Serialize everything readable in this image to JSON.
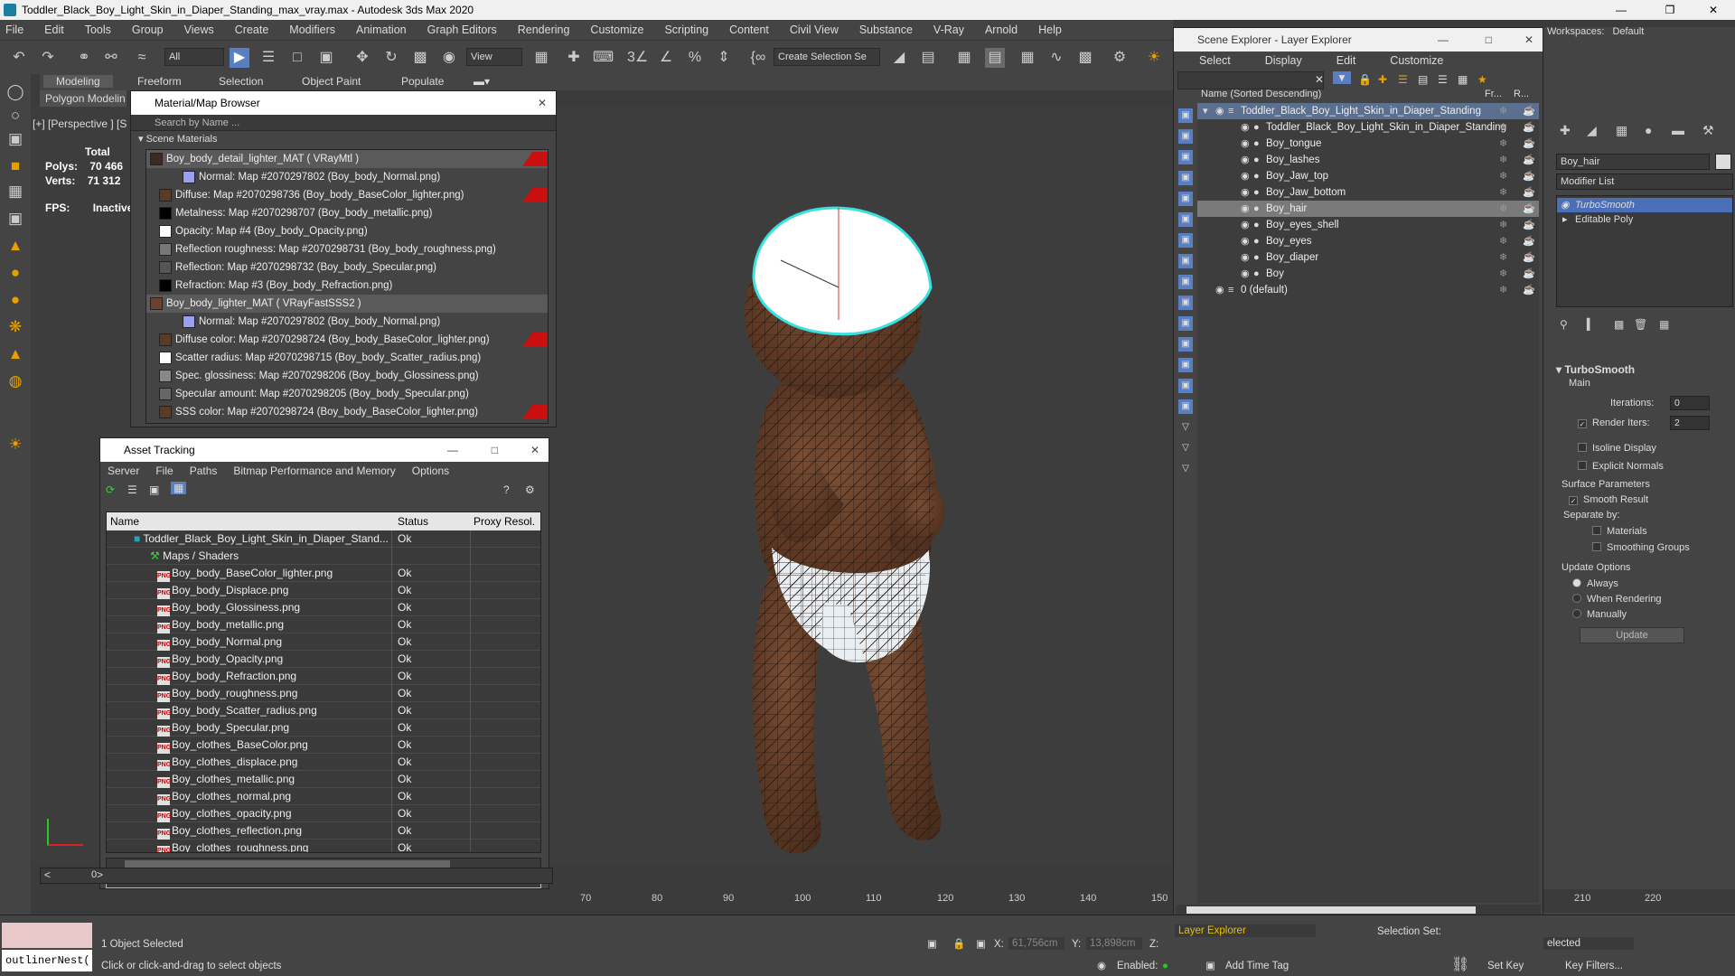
{
  "window": {
    "title": "Toddler_Black_Boy_Light_Skin_in_Diaper_Standing_max_vray.max - Autodesk 3ds Max 2020",
    "workspaces_label": "Workspaces:",
    "workspaces_value": "Default"
  },
  "menu": [
    "File",
    "Edit",
    "Tools",
    "Group",
    "Views",
    "Create",
    "Modifiers",
    "Animation",
    "Graph Editors",
    "Rendering",
    "Customize",
    "Scripting",
    "Content",
    "Civil View",
    "Substance",
    "V-Ray",
    "Arnold",
    "Help"
  ],
  "toolbar": {
    "filter_value": "All",
    "view_value": "View",
    "selection_set_value": "Create Selection Se"
  },
  "ribbon": {
    "tabs": [
      "Modeling",
      "Freeform",
      "Selection",
      "Object Paint",
      "Populate"
    ],
    "sub_tab": "Polygon Modelin"
  },
  "viewport": {
    "label": "[+] [Perspective ] [S",
    "stats_total": "Total",
    "polys_label": "Polys:",
    "polys_value": "70 466",
    "verts_label": "Verts:",
    "verts_value": "71 312",
    "fps_label": "FPS:",
    "fps_value": "Inactive"
  },
  "material_browser": {
    "title": "Material/Map Browser",
    "search_placeholder": "Search by Name ...",
    "section": "Scene Materials",
    "rows": [
      {
        "text": "Boy_body_detail_lighter_MAT  ( VRayMtl )",
        "kind": "mat",
        "swatch": "#3a2a22",
        "red": true
      },
      {
        "text": "Normal: Map #2070297802 (Boy_body_Normal.png)",
        "kind": "map2",
        "swatch": "#9aa0f0",
        "red": false
      },
      {
        "text": "Diffuse: Map #2070298736 (Boy_body_BaseColor_lighter.png)",
        "kind": "map",
        "swatch": "#5a3a28",
        "red": true
      },
      {
        "text": "Metalness: Map #2070298707 (Boy_body_metallic.png)",
        "kind": "map",
        "swatch": "#000000",
        "red": false
      },
      {
        "text": "Opacity: Map #4 (Boy_body_Opacity.png)",
        "kind": "map",
        "swatch": "#ffffff",
        "red": false
      },
      {
        "text": "Reflection roughness: Map #2070298731 (Boy_body_roughness.png)",
        "kind": "map",
        "swatch": "#777777",
        "red": false
      },
      {
        "text": "Reflection: Map #2070298732 (Boy_body_Specular.png)",
        "kind": "map",
        "swatch": "#555555",
        "red": false
      },
      {
        "text": "Refraction: Map #3 (Boy_body_Refraction.png)",
        "kind": "map",
        "swatch": "#000000",
        "red": false
      },
      {
        "text": "Boy_body_lighter_MAT  ( VRayFastSSS2 )",
        "kind": "mat",
        "swatch": "#6a4030",
        "red": false
      },
      {
        "text": "Normal: Map #2070297802 (Boy_body_Normal.png)",
        "kind": "map2",
        "swatch": "#9aa0f0",
        "red": false
      },
      {
        "text": "Diffuse color: Map #2070298724 (Boy_body_BaseColor_lighter.png)",
        "kind": "map",
        "swatch": "#5a3a28",
        "red": true
      },
      {
        "text": "Scatter radius: Map #2070298715 (Boy_body_Scatter_radius.png)",
        "kind": "map",
        "swatch": "#ffffff",
        "red": false
      },
      {
        "text": "Spec. glossiness: Map #2070298206 (Boy_body_Glossiness.png)",
        "kind": "map",
        "swatch": "#888888",
        "red": false
      },
      {
        "text": "Specular amount: Map #2070298205 (Boy_body_Specular.png)",
        "kind": "map",
        "swatch": "#666666",
        "red": false
      },
      {
        "text": "SSS color: Map #2070298724 (Boy_body_BaseColor_lighter.png)",
        "kind": "map",
        "swatch": "#5a3a28",
        "red": true
      }
    ]
  },
  "asset_tracking": {
    "title": "Asset Tracking",
    "menu": [
      "Server",
      "File",
      "Paths",
      "Bitmap Performance and Memory",
      "Options"
    ],
    "col_name": "Name",
    "col_status": "Status",
    "col_proxy": "Proxy Resol.",
    "rows": [
      {
        "name": "Toddler_Black_Boy_Light_Skin_in_Diaper_Stand...",
        "status": "Ok",
        "level": 0
      },
      {
        "name": "Maps / Shaders",
        "status": "",
        "level": 1
      },
      {
        "name": "Boy_body_BaseColor_lighter.png",
        "status": "Ok",
        "level": 2
      },
      {
        "name": "Boy_body_Displace.png",
        "status": "Ok",
        "level": 2
      },
      {
        "name": "Boy_body_Glossiness.png",
        "status": "Ok",
        "level": 2
      },
      {
        "name": "Boy_body_metallic.png",
        "status": "Ok",
        "level": 2
      },
      {
        "name": "Boy_body_Normal.png",
        "status": "Ok",
        "level": 2
      },
      {
        "name": "Boy_body_Opacity.png",
        "status": "Ok",
        "level": 2
      },
      {
        "name": "Boy_body_Refraction.png",
        "status": "Ok",
        "level": 2
      },
      {
        "name": "Boy_body_roughness.png",
        "status": "Ok",
        "level": 2
      },
      {
        "name": "Boy_body_Scatter_radius.png",
        "status": "Ok",
        "level": 2
      },
      {
        "name": "Boy_body_Specular.png",
        "status": "Ok",
        "level": 2
      },
      {
        "name": "Boy_clothes_BaseColor.png",
        "status": "Ok",
        "level": 2
      },
      {
        "name": "Boy_clothes_displace.png",
        "status": "Ok",
        "level": 2
      },
      {
        "name": "Boy_clothes_metallic.png",
        "status": "Ok",
        "level": 2
      },
      {
        "name": "Boy_clothes_normal.png",
        "status": "Ok",
        "level": 2
      },
      {
        "name": "Boy_clothes_opacity.png",
        "status": "Ok",
        "level": 2
      },
      {
        "name": "Boy_clothes_reflection.png",
        "status": "Ok",
        "level": 2
      },
      {
        "name": "Boy_clothes_roughness.png",
        "status": "Ok",
        "level": 2
      }
    ]
  },
  "layer_explorer": {
    "title": "Scene Explorer - Layer Explorer",
    "menu": [
      "Select",
      "Display",
      "Edit",
      "Customize"
    ],
    "col_name": "Name (Sorted Descending)",
    "col_frozen": "Fr...",
    "col_render": "R...",
    "rows": [
      {
        "name": "Toddler_Black_Boy_Light_Skin_in_Diaper_Standing",
        "level": 0,
        "state": "top"
      },
      {
        "name": "Toddler_Black_Boy_Light_Skin_in_Diaper_Standing",
        "level": 1,
        "state": ""
      },
      {
        "name": "Boy_tongue",
        "level": 1,
        "state": ""
      },
      {
        "name": "Boy_lashes",
        "level": 1,
        "state": ""
      },
      {
        "name": "Boy_Jaw_top",
        "level": 1,
        "state": ""
      },
      {
        "name": "Boy_Jaw_bottom",
        "level": 1,
        "state": ""
      },
      {
        "name": "Boy_hair",
        "level": 1,
        "state": "sel"
      },
      {
        "name": "Boy_eyes_shell",
        "level": 1,
        "state": ""
      },
      {
        "name": "Boy_eyes",
        "level": 1,
        "state": ""
      },
      {
        "name": "Boy_diaper",
        "level": 1,
        "state": ""
      },
      {
        "name": "Boy",
        "level": 1,
        "state": ""
      },
      {
        "name": "0 (default)",
        "level": 0,
        "state": ""
      }
    ],
    "footer_dropdown": "Layer Explorer",
    "selection_set_label": "Selection Set:"
  },
  "command_panel": {
    "object_name": "Boy_hair",
    "modifier_list": "Modifier List",
    "stack": [
      "TurboSmooth",
      "Editable Poly"
    ],
    "rollout_title": "TurboSmooth",
    "main_label": "Main",
    "iterations_label": "Iterations:",
    "iterations_value": "0",
    "render_iters_label": "Render Iters:",
    "render_iters_value": "2",
    "isoline_label": "Isoline Display",
    "explicit_normals_label": "Explicit Normals",
    "surface_params_label": "Surface Parameters",
    "smooth_result_label": "Smooth Result",
    "separate_by_label": "Separate by:",
    "materials_label": "Materials",
    "smoothing_groups_label": "Smoothing Groups",
    "update_options_label": "Update Options",
    "always_label": "Always",
    "when_rendering_label": "When Rendering",
    "manually_label": "Manually",
    "update_button": "Update"
  },
  "timeline": {
    "ticks_left": [
      "70",
      "80",
      "90",
      "100",
      "110",
      "120",
      "130",
      "140",
      "150"
    ],
    "ticks_right": [
      "210",
      "220"
    ],
    "frame_counter": "0"
  },
  "status": {
    "selected": "1 Object Selected",
    "hint": "Click or click-and-drag to select objects",
    "x_label": "X:",
    "x_value": "61,756cm",
    "y_label": "Y:",
    "y_value": "13,898cm",
    "z_label": "Z:",
    "enabled_label": "Enabled:",
    "add_time_tag": "Add Time Tag",
    "set_key": "Set Key",
    "key_filters": "Key Filters...",
    "selected_dropdown": "elected",
    "outliner_text": "outlinerNest("
  },
  "colors": {
    "hair_outline": "#38e0e0",
    "selected_row": "#5b6f8e",
    "turbosmooth_highlight": "#4a6fb8",
    "red_flag": "#c81010"
  }
}
